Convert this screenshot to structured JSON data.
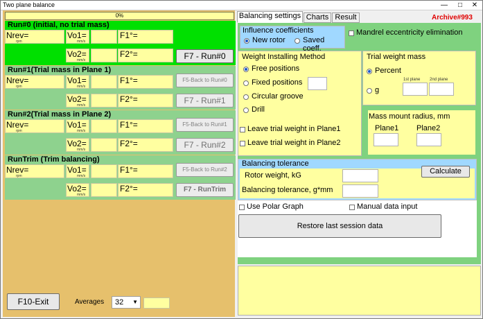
{
  "window": {
    "title": "Two plane balance",
    "controls": [
      "—",
      "□",
      "✕"
    ]
  },
  "progress": {
    "text": "0%",
    "value": 0
  },
  "runs": [
    {
      "title": "Run#0 (initial, no trial mass)",
      "nrev": "Nrev=",
      "rpm": "rpm",
      "vo1": "Vo1=",
      "vo2": "Vo2=",
      "mms": "mm/s",
      "f1": "F1°=",
      "f2": "F2°=",
      "btn_top": "",
      "btn_bottom": "F7 - Run#0"
    },
    {
      "title": "Run#1(Trial mass in Plane 1)",
      "nrev": "Nrev=",
      "rpm": "rpm",
      "vo1": "Vo1=",
      "vo2": "Vo2=",
      "mms": "mm/s",
      "f1": "F1°=",
      "f2": "F2°=",
      "btn_top": "F5-Back to Run#0",
      "btn_bottom": "F7 - Run#1"
    },
    {
      "title": "Run#2(Trial mass in Plane 2)",
      "nrev": "Nrev=",
      "rpm": "rpm",
      "vo1": "Vo1=",
      "vo2": "Vo2=",
      "mms": "mm/s",
      "f1": "F1°=",
      "f2": "F2°=",
      "btn_top": "F5-Back to Run#1",
      "btn_bottom": "F7 - Run#2"
    },
    {
      "title": "RunTrim (Trim balancing)",
      "nrev": "Nrev=",
      "rpm": "rpm",
      "vo1": "Vo1=",
      "vo2": "Vo2=",
      "mms": "mm/s",
      "f1": "F1°=",
      "f2": "F2°=",
      "btn_top": "F5-Back to Run#2",
      "btn_bottom": "F7 - RunTrim"
    }
  ],
  "footer": {
    "exit_label": "F10-Exit",
    "averages_label": "Averages",
    "averages_value": "32",
    "averages_extra": ""
  },
  "tabs": [
    "Balancing settings",
    "Charts",
    "Result"
  ],
  "archive": "Archive#993",
  "influence": {
    "title": "Influence coefficients",
    "opt1": "New rotor",
    "opt2": "Saved coeff."
  },
  "mandrel": "Mandrel eccentricity elimination",
  "weight_method": {
    "title": "Weight Installing Method",
    "opts": [
      "Free positions",
      "Fixed positions",
      "Circular groove",
      "Drill"
    ],
    "fixed_value": ""
  },
  "trial_mass": {
    "title": "Trial weight mass",
    "percent": "Percent",
    "g": "g",
    "plane1_label": "1st plane",
    "plane2_label": "2nd plane"
  },
  "mount_radius": {
    "title": "Mass mount radius, mm",
    "plane1": "Plane1",
    "plane2": "Plane2"
  },
  "leave1": "Leave trial weight in Plane1",
  "leave2": "Leave trial weight in Plane2",
  "tolerance": {
    "title": "Balancing tolerance",
    "rotor_weight": "Rotor weight, kG",
    "tolerance_label": "Balancing tolerance, g*mm",
    "calc": "Calculate"
  },
  "use_polar": "Use Polar Graph",
  "manual": "Manual data input",
  "restore": "Restore last session data",
  "colors": {
    "left_bg": "#e6c06c",
    "run_green": "#00e000",
    "run_light": "#8ed28e",
    "field_yellow": "#ffffa0",
    "archive_red": "#e00000"
  }
}
